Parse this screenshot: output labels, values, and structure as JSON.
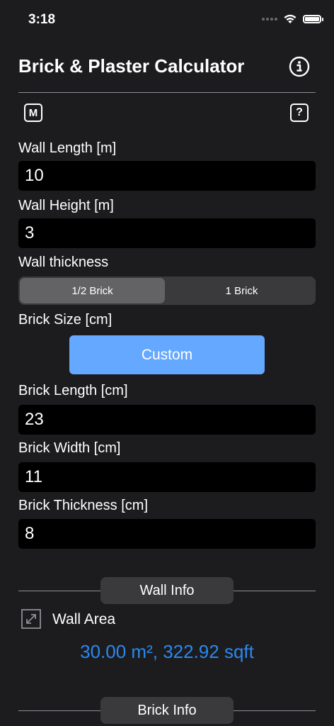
{
  "status_bar": {
    "time": "3:18"
  },
  "header": {
    "title": "Brick & Plaster Calculator",
    "m_label": "M",
    "help_label": "?"
  },
  "form": {
    "wall_length_label": "Wall Length [m]",
    "wall_length_value": "10",
    "wall_height_label": "Wall Height [m]",
    "wall_height_value": "3",
    "wall_thickness_label": "Wall thickness",
    "thickness_options": [
      "1/2 Brick",
      "1 Brick"
    ],
    "thickness_selected": "1/2 Brick",
    "brick_size_label": "Brick Size [cm]",
    "brick_size_button": "Custom",
    "brick_length_label": "Brick Length [cm]",
    "brick_length_value": "23",
    "brick_width_label": "Brick Width [cm]",
    "brick_width_value": "11",
    "brick_thickness_label": "Brick Thickness [cm]",
    "brick_thickness_value": "8"
  },
  "wall_info": {
    "section_title": "Wall Info",
    "wall_area_label": "Wall Area",
    "wall_area_value": "30.00 m², 322.92 sqft"
  },
  "brick_info": {
    "section_title": "Brick Info"
  },
  "colors": {
    "accent": "#2a88ee",
    "button": "#64a8ff",
    "background": "#1c1c1e"
  }
}
